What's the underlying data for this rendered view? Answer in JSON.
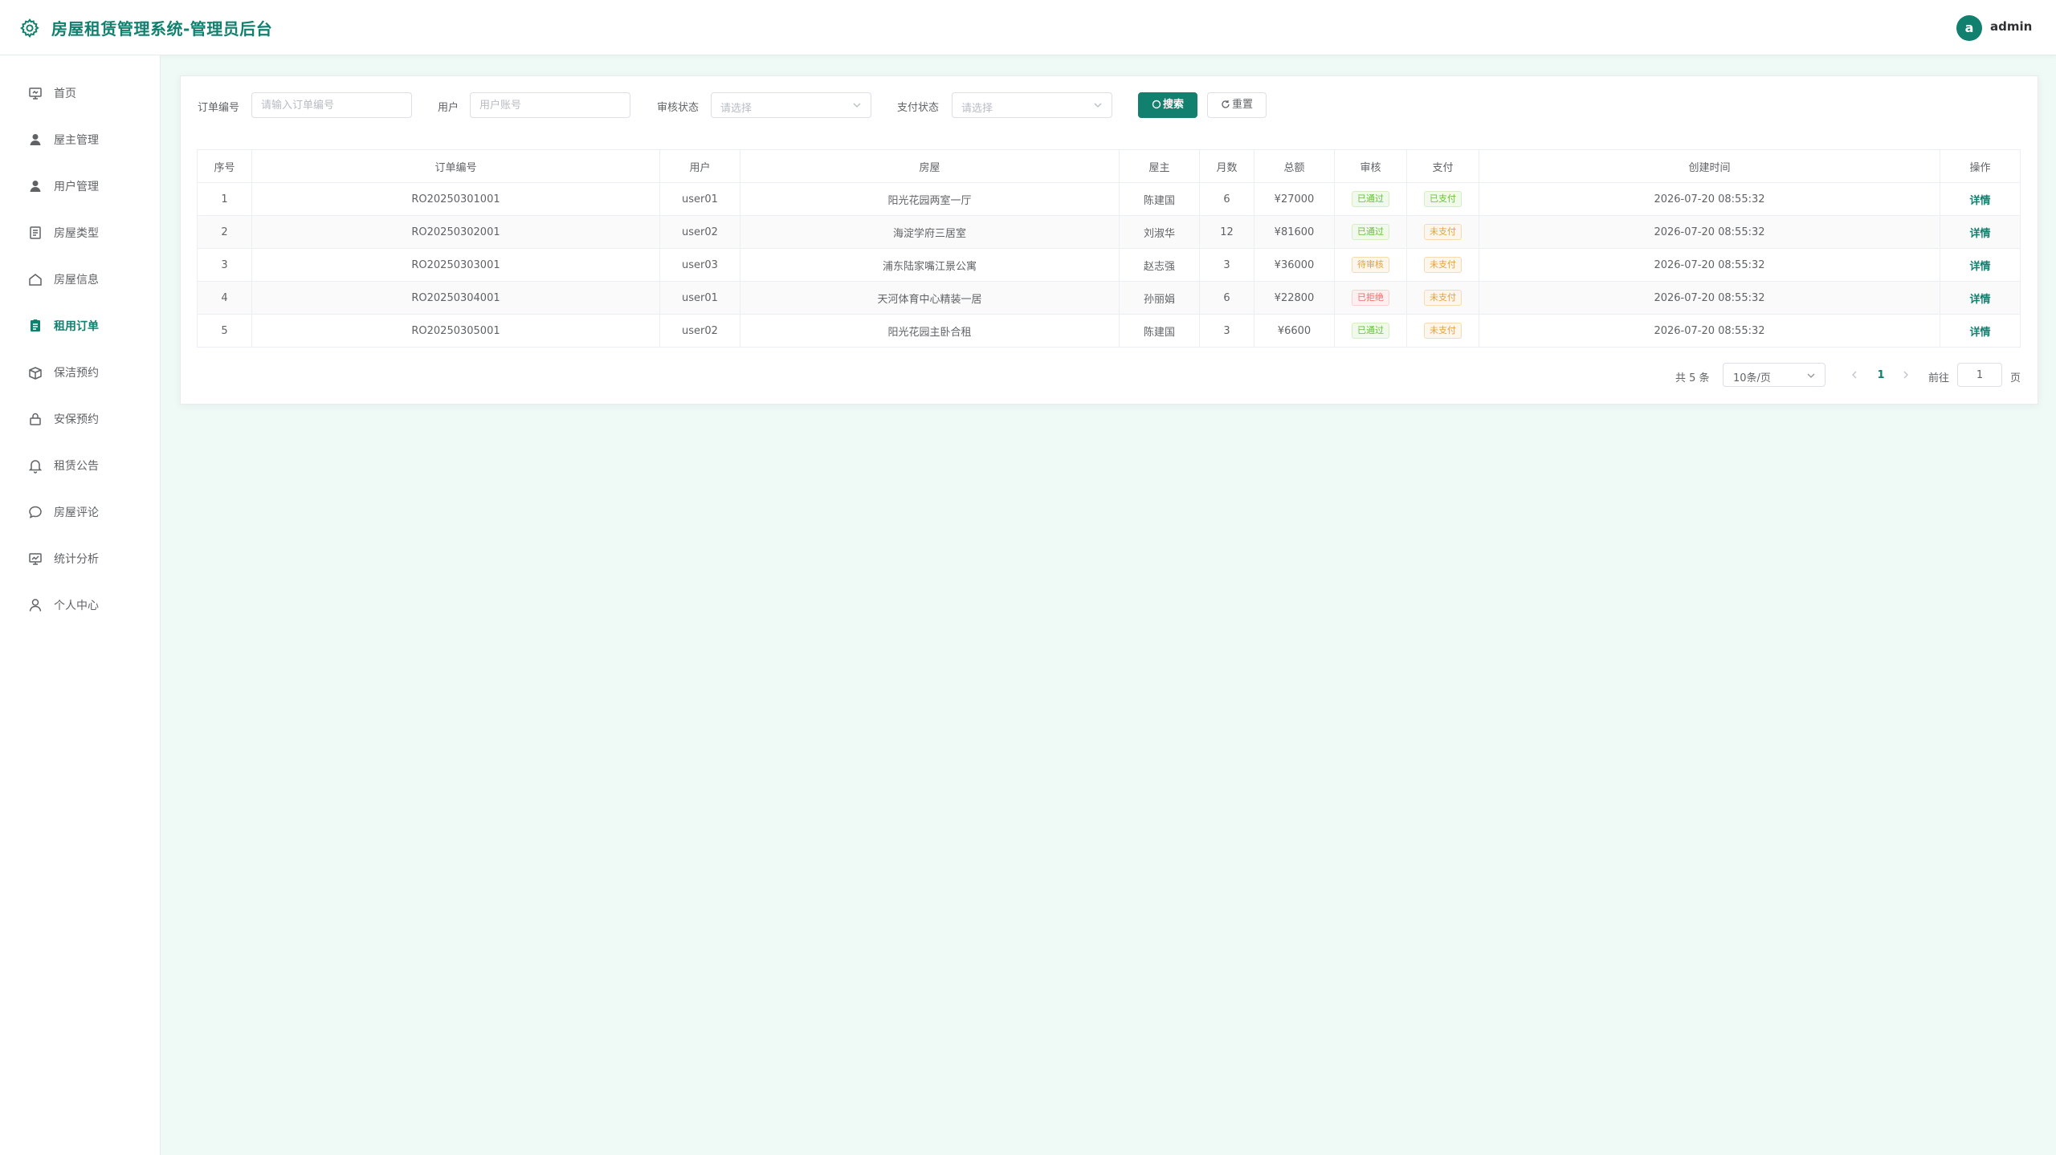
{
  "header": {
    "title": "房屋租赁管理系统-管理员后台",
    "avatar_letter": "a",
    "username": "admin",
    "accent": "#12806f"
  },
  "sidebar": {
    "items": [
      {
        "label": "首页",
        "icon": "home-monitor-icon",
        "active": false
      },
      {
        "label": "屋主管理",
        "icon": "user-solid-icon",
        "active": false
      },
      {
        "label": "用户管理",
        "icon": "user-solid-icon",
        "active": false
      },
      {
        "label": "房屋类型",
        "icon": "notebook-icon",
        "active": false
      },
      {
        "label": "房屋信息",
        "icon": "house-icon",
        "active": false
      },
      {
        "label": "租用订单",
        "icon": "document-icon",
        "active": true
      },
      {
        "label": "保洁预约",
        "icon": "box-icon",
        "active": false
      },
      {
        "label": "安保预约",
        "icon": "lock-icon",
        "active": false
      },
      {
        "label": "租赁公告",
        "icon": "bell-icon",
        "active": false
      },
      {
        "label": "房屋评论",
        "icon": "chat-icon",
        "active": false
      },
      {
        "label": "统计分析",
        "icon": "monitor-icon",
        "active": false
      },
      {
        "label": "个人中心",
        "icon": "user-icon",
        "active": false
      }
    ]
  },
  "filters": {
    "order_no_label": "订单编号",
    "order_no_placeholder": "请输入订单编号",
    "user_label": "用户",
    "user_placeholder": "用户账号",
    "audit_label": "审核状态",
    "audit_placeholder": "请选择",
    "pay_label": "支付状态",
    "pay_placeholder": "请选择",
    "search_label": "搜索",
    "reset_label": "重置"
  },
  "table": {
    "columns": [
      "序号",
      "订单编号",
      "用户",
      "房屋",
      "屋主",
      "月数",
      "总额",
      "审核",
      "支付",
      "创建时间",
      "操作"
    ],
    "rows": [
      {
        "idx": "1",
        "order_no": "RO20250301001",
        "user": "user01",
        "house": "阳光花园两室一厅",
        "owner": "陈建国",
        "months": "6",
        "total": "¥27000",
        "audit": "已通过",
        "audit_type": "success",
        "pay": "已支付",
        "pay_type": "success",
        "created": "2026-07-20 08:55:32",
        "action": "详情"
      },
      {
        "idx": "2",
        "order_no": "RO20250302001",
        "user": "user02",
        "house": "海淀学府三居室",
        "owner": "刘淑华",
        "months": "12",
        "total": "¥81600",
        "audit": "已通过",
        "audit_type": "success",
        "pay": "未支付",
        "pay_type": "warning",
        "created": "2026-07-20 08:55:32",
        "action": "详情"
      },
      {
        "idx": "3",
        "order_no": "RO20250303001",
        "user": "user03",
        "house": "浦东陆家嘴江景公寓",
        "owner": "赵志强",
        "months": "3",
        "total": "¥36000",
        "audit": "待审核",
        "audit_type": "warning",
        "pay": "未支付",
        "pay_type": "warning",
        "created": "2026-07-20 08:55:32",
        "action": "详情"
      },
      {
        "idx": "4",
        "order_no": "RO20250304001",
        "user": "user01",
        "house": "天河体育中心精装一居",
        "owner": "孙丽娟",
        "months": "6",
        "total": "¥22800",
        "audit": "已拒绝",
        "audit_type": "danger",
        "pay": "未支付",
        "pay_type": "warning",
        "created": "2026-07-20 08:55:32",
        "action": "详情"
      },
      {
        "idx": "5",
        "order_no": "RO20250305001",
        "user": "user02",
        "house": "阳光花园主卧合租",
        "owner": "陈建国",
        "months": "3",
        "total": "¥6600",
        "audit": "已通过",
        "audit_type": "success",
        "pay": "未支付",
        "pay_type": "warning",
        "created": "2026-07-20 08:55:32",
        "action": "详情"
      }
    ]
  },
  "pagination": {
    "total_text": "共 5 条",
    "page_size": "10条/页",
    "current_page": "1",
    "goto_label": "前往",
    "goto_value": "1",
    "goto_unit": "页"
  }
}
